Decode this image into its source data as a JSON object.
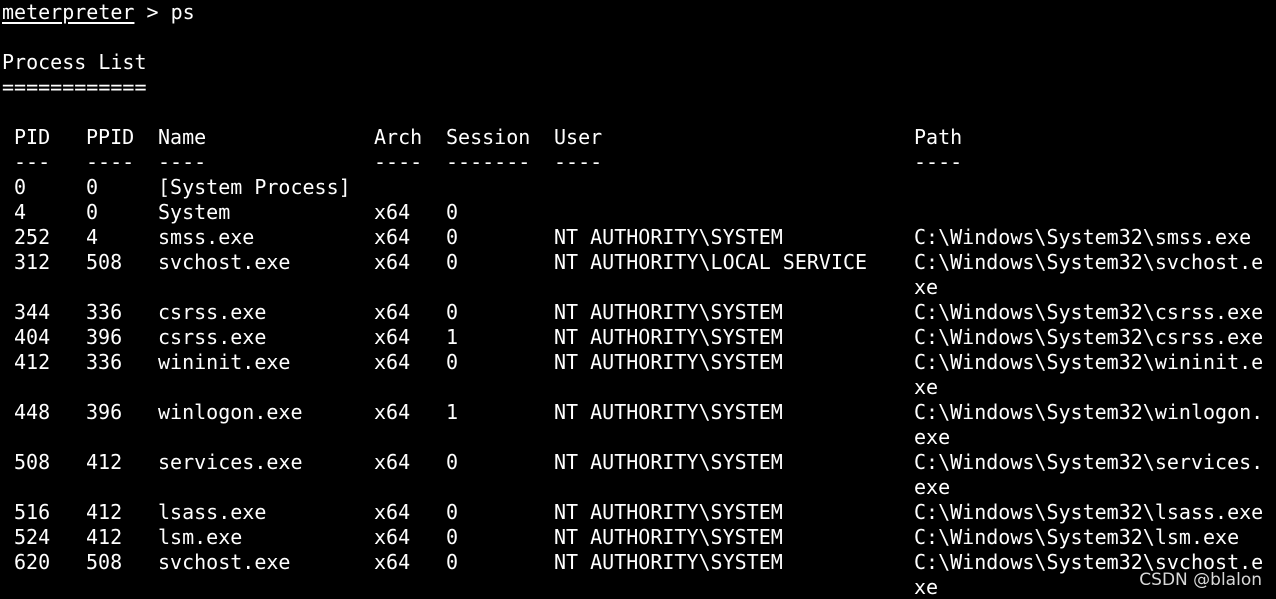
{
  "prompt": {
    "name": "meterpreter",
    "separator": " > ",
    "command": "ps"
  },
  "heading": {
    "title": "Process List",
    "underline": "============"
  },
  "table": {
    "headers": {
      "pid": "PID",
      "ppid": "PPID",
      "name": "Name",
      "arch": "Arch",
      "session": "Session",
      "user": "User",
      "path": "Path"
    },
    "dividers": {
      "pid": "---",
      "ppid": "----",
      "name": "----",
      "arch": "----",
      "session": "-------",
      "user": "----",
      "path": "----"
    },
    "lines": [
      {
        "pid": "0",
        "ppid": "0",
        "name": "[System Process]",
        "arch": "",
        "session": "",
        "user": "",
        "path": ""
      },
      {
        "pid": "4",
        "ppid": "0",
        "name": "System",
        "arch": "x64",
        "session": "0",
        "user": "",
        "path": ""
      },
      {
        "pid": "252",
        "ppid": "4",
        "name": "smss.exe",
        "arch": "x64",
        "session": "0",
        "user": "NT AUTHORITY\\SYSTEM",
        "path": "C:\\Windows\\System32\\smss.exe"
      },
      {
        "pid": "312",
        "ppid": "508",
        "name": "svchost.exe",
        "arch": "x64",
        "session": "0",
        "user": "NT AUTHORITY\\LOCAL SERVICE",
        "path": "C:\\Windows\\System32\\svchost.e"
      },
      {
        "pid": "",
        "ppid": "",
        "name": "",
        "arch": "",
        "session": "",
        "user": "",
        "path": "xe"
      },
      {
        "pid": "344",
        "ppid": "336",
        "name": "csrss.exe",
        "arch": "x64",
        "session": "0",
        "user": "NT AUTHORITY\\SYSTEM",
        "path": "C:\\Windows\\System32\\csrss.exe"
      },
      {
        "pid": "404",
        "ppid": "396",
        "name": "csrss.exe",
        "arch": "x64",
        "session": "1",
        "user": "NT AUTHORITY\\SYSTEM",
        "path": "C:\\Windows\\System32\\csrss.exe"
      },
      {
        "pid": "412",
        "ppid": "336",
        "name": "wininit.exe",
        "arch": "x64",
        "session": "0",
        "user": "NT AUTHORITY\\SYSTEM",
        "path": "C:\\Windows\\System32\\wininit.e"
      },
      {
        "pid": "",
        "ppid": "",
        "name": "",
        "arch": "",
        "session": "",
        "user": "",
        "path": "xe"
      },
      {
        "pid": "448",
        "ppid": "396",
        "name": "winlogon.exe",
        "arch": "x64",
        "session": "1",
        "user": "NT AUTHORITY\\SYSTEM",
        "path": "C:\\Windows\\System32\\winlogon."
      },
      {
        "pid": "",
        "ppid": "",
        "name": "",
        "arch": "",
        "session": "",
        "user": "",
        "path": "exe"
      },
      {
        "pid": "508",
        "ppid": "412",
        "name": "services.exe",
        "arch": "x64",
        "session": "0",
        "user": "NT AUTHORITY\\SYSTEM",
        "path": "C:\\Windows\\System32\\services."
      },
      {
        "pid": "",
        "ppid": "",
        "name": "",
        "arch": "",
        "session": "",
        "user": "",
        "path": "exe"
      },
      {
        "pid": "516",
        "ppid": "412",
        "name": "lsass.exe",
        "arch": "x64",
        "session": "0",
        "user": "NT AUTHORITY\\SYSTEM",
        "path": "C:\\Windows\\System32\\lsass.exe"
      },
      {
        "pid": "524",
        "ppid": "412",
        "name": "lsm.exe",
        "arch": "x64",
        "session": "0",
        "user": "NT AUTHORITY\\SYSTEM",
        "path": "C:\\Windows\\System32\\lsm.exe"
      },
      {
        "pid": "620",
        "ppid": "508",
        "name": "svchost.exe",
        "arch": "x64",
        "session": "0",
        "user": "NT AUTHORITY\\SYSTEM",
        "path": "C:\\Windows\\System32\\svchost.e"
      },
      {
        "pid": "",
        "ppid": "",
        "name": "",
        "arch": "",
        "session": "",
        "user": "",
        "path": "xe"
      }
    ]
  },
  "watermark": "CSDN @blalon",
  "colors": {
    "background": "#000000",
    "foreground": "#ffffff"
  }
}
